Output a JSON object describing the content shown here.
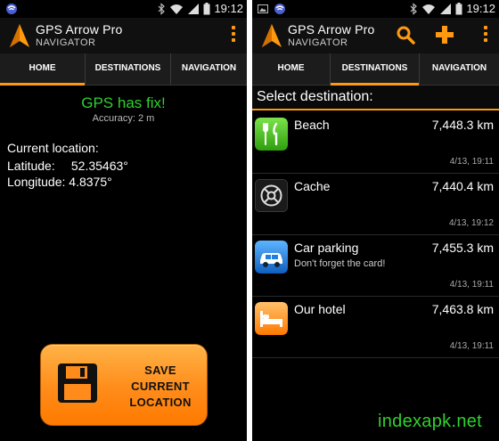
{
  "status_bar": {
    "time": "19:12"
  },
  "app": {
    "title": "GPS Arrow Pro",
    "subtitle": "NAVIGATOR"
  },
  "tabs": [
    {
      "label": "HOME"
    },
    {
      "label": "DESTINATIONS"
    },
    {
      "label": "NAVIGATION"
    }
  ],
  "home": {
    "gps_status": "GPS has fix!",
    "accuracy": "Accuracy: 2 m",
    "current_location_label": "Current location:",
    "latitude_label": "Latitude:",
    "latitude_value": "52.35463°",
    "longitude_label": "Longitude:",
    "longitude_value": "4.8375°",
    "save_button": {
      "line1": "SAVE",
      "line2": "CURRENT",
      "line3": "LOCATION"
    }
  },
  "destinations": {
    "heading": "Select destination:",
    "items": [
      {
        "name": "Beach",
        "note": "",
        "distance": "7,448.3 km",
        "date": "4/13, 19:11",
        "icon": "restaurant-icon",
        "color": "#3fc11a"
      },
      {
        "name": "Cache",
        "note": "",
        "distance": "7,440.4 km",
        "date": "4/13, 19:12",
        "icon": "geocache-icon",
        "color": "#222222"
      },
      {
        "name": "Car parking",
        "note": "Don't forget the card!",
        "distance": "7,455.3 km",
        "date": "4/13, 19:11",
        "icon": "car-icon",
        "color": "#1e7fe0"
      },
      {
        "name": "Our hotel",
        "note": "",
        "distance": "7,463.8 km",
        "date": "4/13, 19:11",
        "icon": "bed-icon",
        "color": "#ff8a10"
      }
    ]
  },
  "colors": {
    "accent": "#ff9a10",
    "gps_fix": "#2fd12f"
  },
  "watermark": "indexapk.net"
}
